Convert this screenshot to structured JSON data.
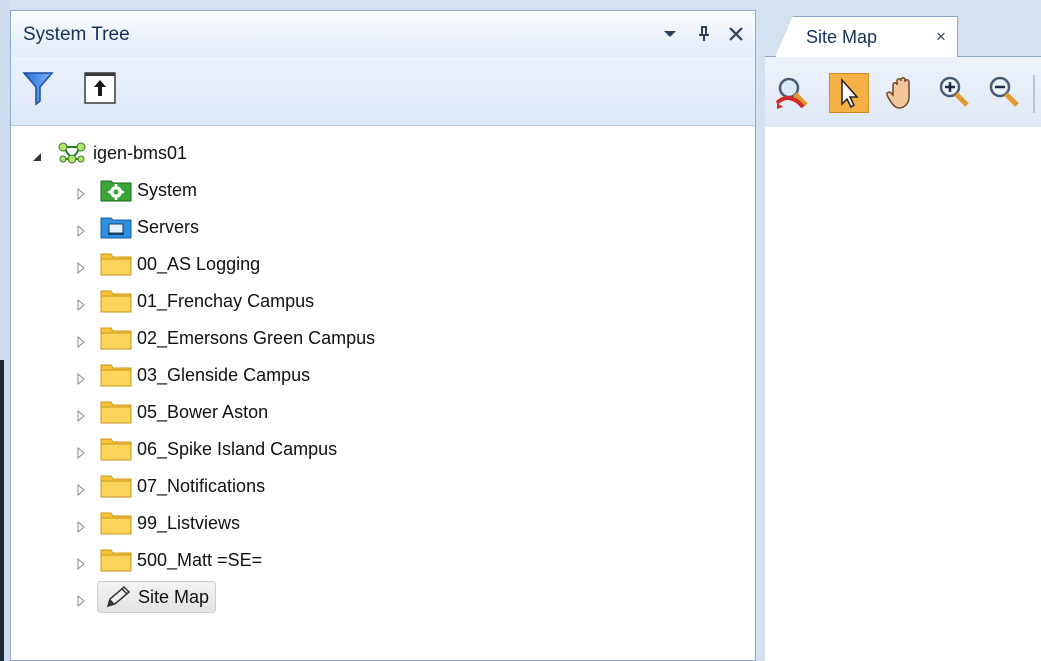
{
  "tree_panel": {
    "title": "System Tree",
    "header_buttons": [
      "chevron-down-icon",
      "pin-icon",
      "close-icon"
    ],
    "toolbar": [
      "filter-icon",
      "collapse-all-icon"
    ],
    "root": {
      "label": "igen-bms01",
      "icon": "network-icon",
      "expanded": true
    },
    "items": [
      {
        "label": "System",
        "icon": "system-gear-icon"
      },
      {
        "label": "Servers",
        "icon": "server-icon"
      },
      {
        "label": "00_AS Logging",
        "icon": "folder-icon"
      },
      {
        "label": "01_Frenchay Campus",
        "icon": "folder-icon"
      },
      {
        "label": "02_Emersons Green Campus",
        "icon": "folder-icon"
      },
      {
        "label": "03_Glenside Campus",
        "icon": "folder-icon"
      },
      {
        "label": "05_Bower Aston",
        "icon": "folder-icon"
      },
      {
        "label": "06_Spike Island Campus",
        "icon": "folder-icon"
      },
      {
        "label": "07_Notifications",
        "icon": "folder-icon"
      },
      {
        "label": "99_Listviews",
        "icon": "folder-icon"
      },
      {
        "label": "500_Matt =SE=",
        "icon": "folder-icon"
      },
      {
        "label": "Site Map",
        "icon": "pencil-icon",
        "selected": true
      }
    ]
  },
  "document": {
    "tab_label": "Site Map",
    "tab_close": "×",
    "toolbar": [
      "zoom-extents-icon",
      "select-arrow-icon",
      "pan-hand-icon",
      "zoom-in-icon",
      "zoom-out-icon"
    ],
    "active_tool": "select-arrow-icon"
  },
  "colors": {
    "panel_border": "#8ea8cc",
    "header_text": "#15315a",
    "folder": "#f8c53a",
    "active_tool": "#f5b046"
  }
}
